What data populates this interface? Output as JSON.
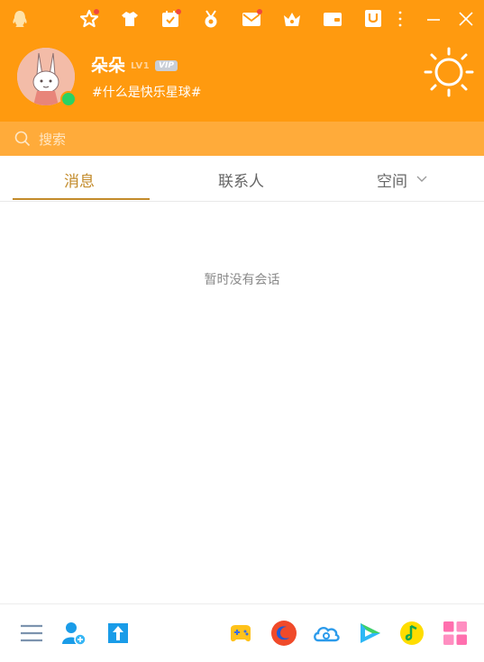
{
  "profile": {
    "nickname": "朵朵",
    "level": "LV1",
    "vip": "VIP",
    "signature": "#什么是快乐星球#",
    "status": "online"
  },
  "search": {
    "placeholder": "搜索"
  },
  "tabs": [
    {
      "label": "消息",
      "active": true
    },
    {
      "label": "联系人",
      "active": false
    },
    {
      "label": "空间",
      "active": false
    }
  ],
  "messages": {
    "empty_text": "暂时没有会话"
  },
  "toolbar_icons": [
    "qq-logo-icon",
    "star-icon",
    "shirt-icon",
    "calendar-icon",
    "medal-icon",
    "mail-icon",
    "crown-shop-icon",
    "wallet-icon",
    "u-icon",
    "more-icon",
    "minimize-icon",
    "close-icon"
  ],
  "footer_icons": [
    "menu-icon",
    "add-contact-icon",
    "file-transfer-icon",
    "game-icon",
    "browser-icon",
    "weather-cloud-icon",
    "video-play-icon",
    "music-icon",
    "apps-grid-icon"
  ],
  "colors": {
    "header": "#FF9A0F",
    "search_bar": "#FFAB3A",
    "accent": "#C28A29",
    "online": "#29D263"
  }
}
